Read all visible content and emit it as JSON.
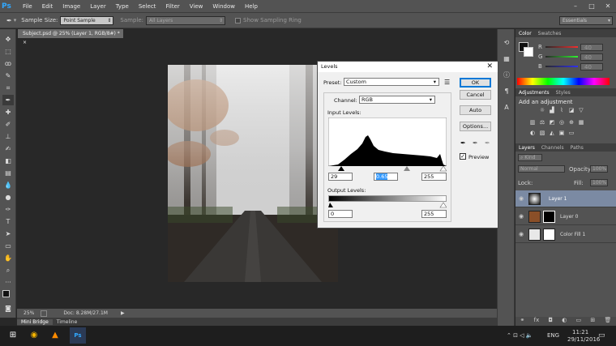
{
  "app": {
    "logo": "Ps"
  },
  "menu": [
    "File",
    "Edit",
    "Image",
    "Layer",
    "Type",
    "Select",
    "Filter",
    "View",
    "Window",
    "Help"
  ],
  "window_controls": {
    "min": "–",
    "max": "□",
    "close": "✕"
  },
  "options_bar": {
    "sample_size_label": "Sample Size:",
    "sample_size_value": "Point Sample",
    "sample_label": "Sample:",
    "sample_value": "All Layers",
    "sampling_ring_label": "Show Sampling Ring",
    "workspace": "Essentials"
  },
  "document_tab": {
    "title": "Subject.psd @ 25% (Layer 1, RGB/8#) *",
    "close": "×"
  },
  "status": {
    "zoom": "25%",
    "doc": "Doc: 8.28M/27.1M"
  },
  "bottom_tabs": [
    "Mini Bridge",
    "Timeline"
  ],
  "color_panel": {
    "tabs": [
      "Color",
      "Swatches"
    ],
    "channels": [
      "R",
      "G",
      "B"
    ],
    "values": [
      "40",
      "40",
      "40"
    ]
  },
  "adjustments_panel": {
    "tabs": [
      "Adjustments",
      "Styles"
    ],
    "heading": "Add an adjustment"
  },
  "layers_panel": {
    "tabs": [
      "Layers",
      "Channels",
      "Paths"
    ],
    "kind": "Kind",
    "blend_mode": "Normal",
    "opacity_label": "Opacity:",
    "opacity": "100%",
    "lock_label": "Lock:",
    "fill_label": "Fill:",
    "fill": "100%",
    "layers": [
      {
        "name": "Layer 1",
        "selected": true
      },
      {
        "name": "Layer 0",
        "selected": false
      },
      {
        "name": "Color Fill 1",
        "selected": false
      }
    ]
  },
  "levels_dialog": {
    "title": "Levels",
    "preset_label": "Preset:",
    "preset_value": "Custom",
    "channel_label": "Channel:",
    "channel_value": "RGB",
    "input_label": "Input Levels:",
    "input_black": "29",
    "input_gamma": "0.65",
    "input_white": "255",
    "output_label": "Output Levels:",
    "output_black": "0",
    "output_white": "255",
    "buttons": {
      "ok": "OK",
      "cancel": "Cancel",
      "auto": "Auto",
      "options": "Options..."
    },
    "preview_label": "Preview",
    "preview_checked": true
  },
  "taskbar": {
    "time": "11:21",
    "date": "29/11/2016",
    "lang": "ENG"
  }
}
